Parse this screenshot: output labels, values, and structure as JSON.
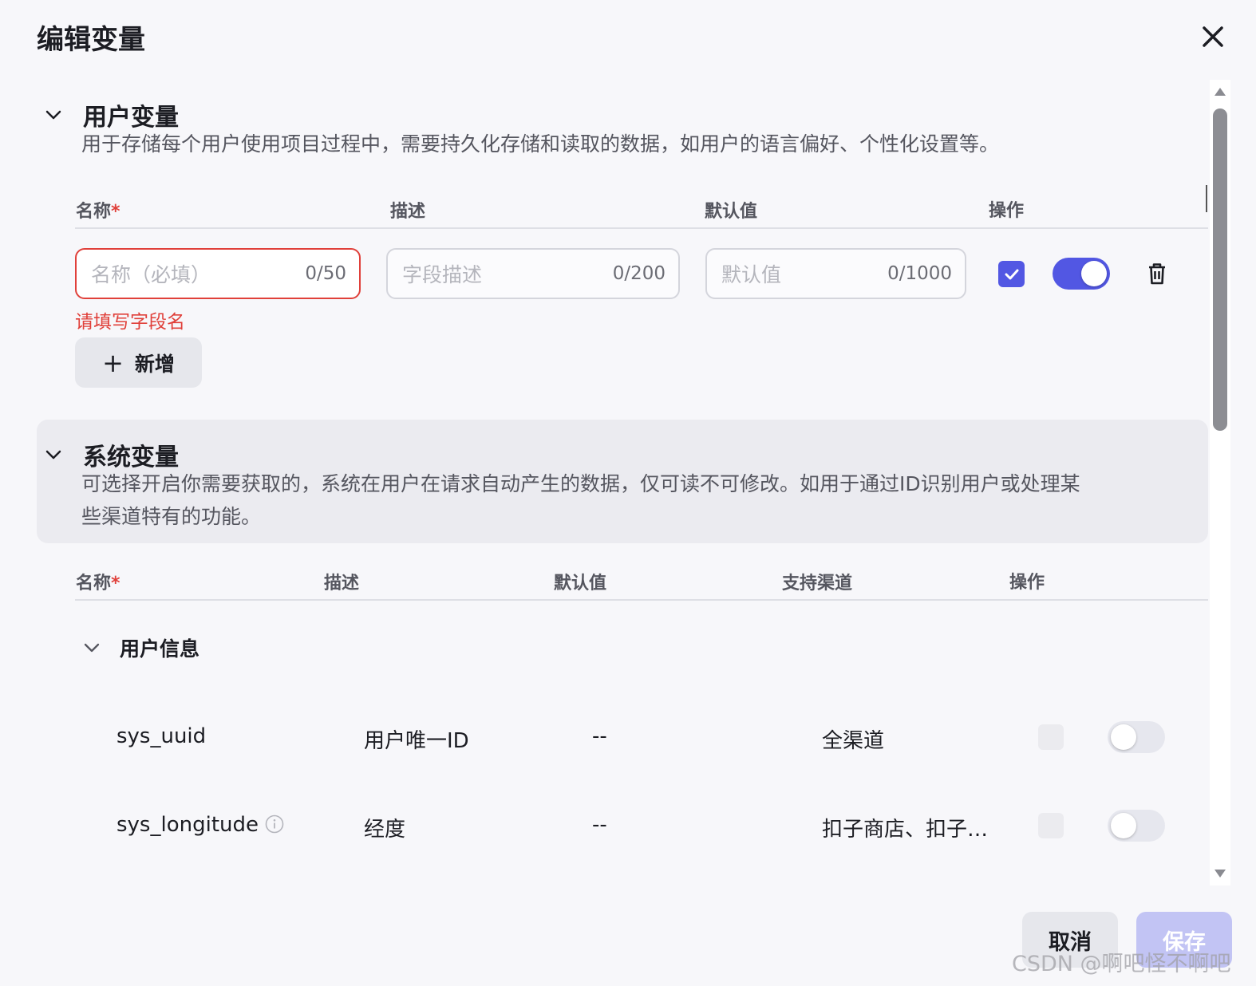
{
  "dialog": {
    "title": "编辑变量"
  },
  "user_vars": {
    "title": "用户变量",
    "desc": "用于存储每个用户使用项目过程中，需要持久化存储和读取的数据，如用户的语言偏好、个性化设置等。",
    "columns": {
      "name": "名称",
      "required_mark": "*",
      "desc": "描述",
      "default": "默认值",
      "ops": "操作"
    },
    "row": {
      "name_placeholder": "名称（必填）",
      "name_count": "0/50",
      "desc_placeholder": "字段描述",
      "desc_count": "0/200",
      "default_placeholder": "默认值",
      "default_count": "0/1000",
      "checked": true,
      "toggle_on": true
    },
    "error": "请填写字段名",
    "add_label": "新增"
  },
  "sys_vars": {
    "title": "系统变量",
    "desc_line1": "可选择开启你需要获取的，系统在用户在请求自动产生的数据，仅可读不可修改。如用于通过ID识别用户或处理某",
    "desc_line2": "些渠道特有的功能。",
    "columns": {
      "name": "名称",
      "required_mark": "*",
      "desc": "描述",
      "default": "默认值",
      "channels": "支持渠道",
      "ops": "操作"
    },
    "group": {
      "title": "用户信息"
    },
    "rows": [
      {
        "name": "sys_uuid",
        "desc": "用户唯一ID",
        "default": "--",
        "channels": "全渠道",
        "enabled": false
      },
      {
        "name": "sys_longitude",
        "desc": "经度",
        "default": "--",
        "channels": "扣子商店、扣子…",
        "enabled": false
      }
    ]
  },
  "footer": {
    "cancel": "取消",
    "save": "保存"
  },
  "watermark": "CSDN @啊吧怪不啊吧",
  "colors": {
    "accent": "#5257e3",
    "error": "#e0403a",
    "panel": "#ebebf0"
  },
  "icons": {
    "close": "close-icon",
    "chevron": "chevron-down-icon",
    "check": "check-icon",
    "trash": "trash-icon",
    "info": "info-icon",
    "plus": "plus-icon"
  }
}
